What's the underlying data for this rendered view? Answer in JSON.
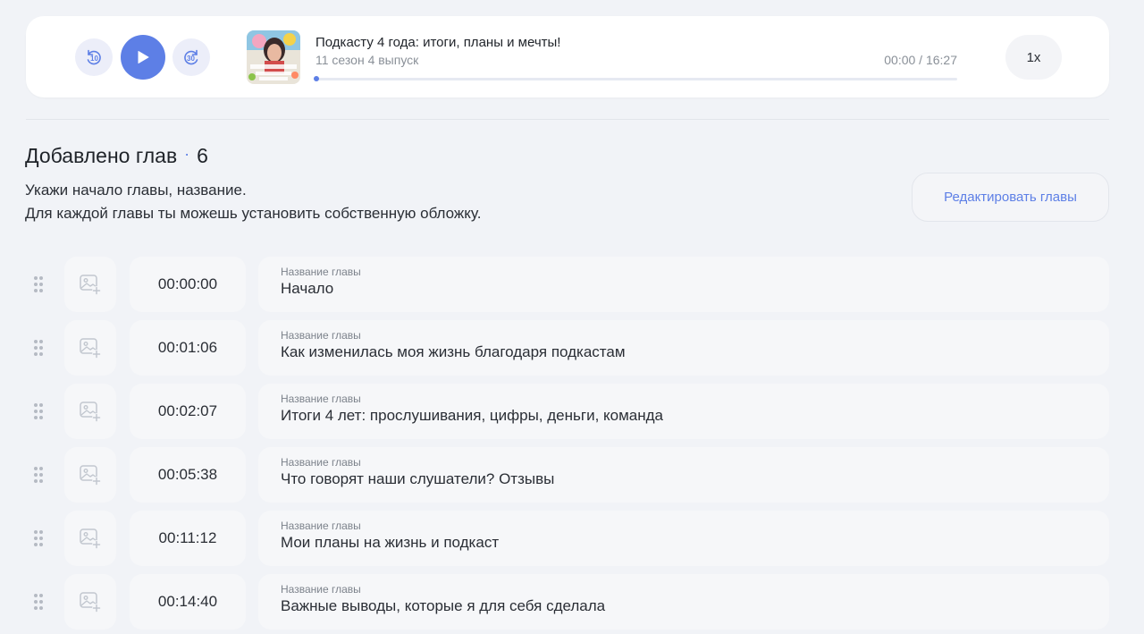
{
  "player": {
    "skip_back_label": "10",
    "skip_forward_label": "30",
    "episode_title": "Подкасту 4 года: итоги, планы и мечты!",
    "episode_subtitle": "11 сезон 4 выпуск",
    "time_display": "00:00 / 16:27",
    "progress_fraction": 0.0,
    "speed_label": "1x",
    "accent_color": "#5d7fe6"
  },
  "chapters_header": {
    "title": "Добавлено глав",
    "separator": "·",
    "count": "6",
    "description_line1": "Укажи начало главы, название.",
    "description_line2": "Для каждой главы ты можешь установить собственную обложку.",
    "edit_button_label": "Редактировать главы"
  },
  "chapters": [
    {
      "time": "00:00:00",
      "label": "Название главы",
      "name": "Начало"
    },
    {
      "time": "00:01:06",
      "label": "Название главы",
      "name": "Как изменилась моя жизнь благодаря подкастам"
    },
    {
      "time": "00:02:07",
      "label": "Название главы",
      "name": "Итоги 4 лет: прослушивания, цифры, деньги, команда"
    },
    {
      "time": "00:05:38",
      "label": "Название главы",
      "name": "Что говорят наши слушатели? Отзывы"
    },
    {
      "time": "00:11:12",
      "label": "Название главы",
      "name": "Мои планы на жизнь и подкаст"
    },
    {
      "time": "00:14:40",
      "label": "Название главы",
      "name": "Важные выводы, которые я для себя сделала"
    }
  ],
  "icons": {
    "drag": "drag-handle-icon",
    "image_add": "add-image-icon",
    "play": "play-icon",
    "rewind": "rewind-10-icon",
    "forward": "forward-30-icon"
  }
}
